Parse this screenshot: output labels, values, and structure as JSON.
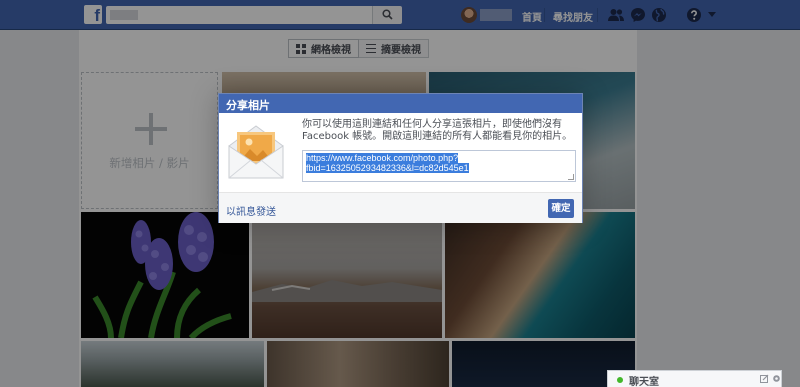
{
  "topbar": {
    "logo": "f",
    "nav_home": "首頁",
    "nav_find_friends": "尋找朋友",
    "icons": [
      "friend-requests-icon",
      "messages-icon",
      "notifications-globe-icon",
      "help-icon",
      "account-menu-caret-icon"
    ]
  },
  "view_toggle": {
    "grid_label": "網格檢視",
    "summary_label": "摘要檢視"
  },
  "album": {
    "add_label": "新增相片 / 影片"
  },
  "dialog": {
    "title": "分享相片",
    "description": "你可以使用這則連結和任何人分享這張相片，即使他們沒有 Facebook 帳號。開啟這則連結的所有人都能看見你的相片。",
    "url_line1": "https://www.facebook.com/photo.php?",
    "url_line2": "fbid=1632505293482336&l=dc82d545e1",
    "send_link": "以訊息發送",
    "ok_label": "確定"
  },
  "chat": {
    "label": "聊天室",
    "status_color": "#42b72a"
  },
  "colors": {
    "brand": "#4267b2",
    "link": "#365899"
  }
}
